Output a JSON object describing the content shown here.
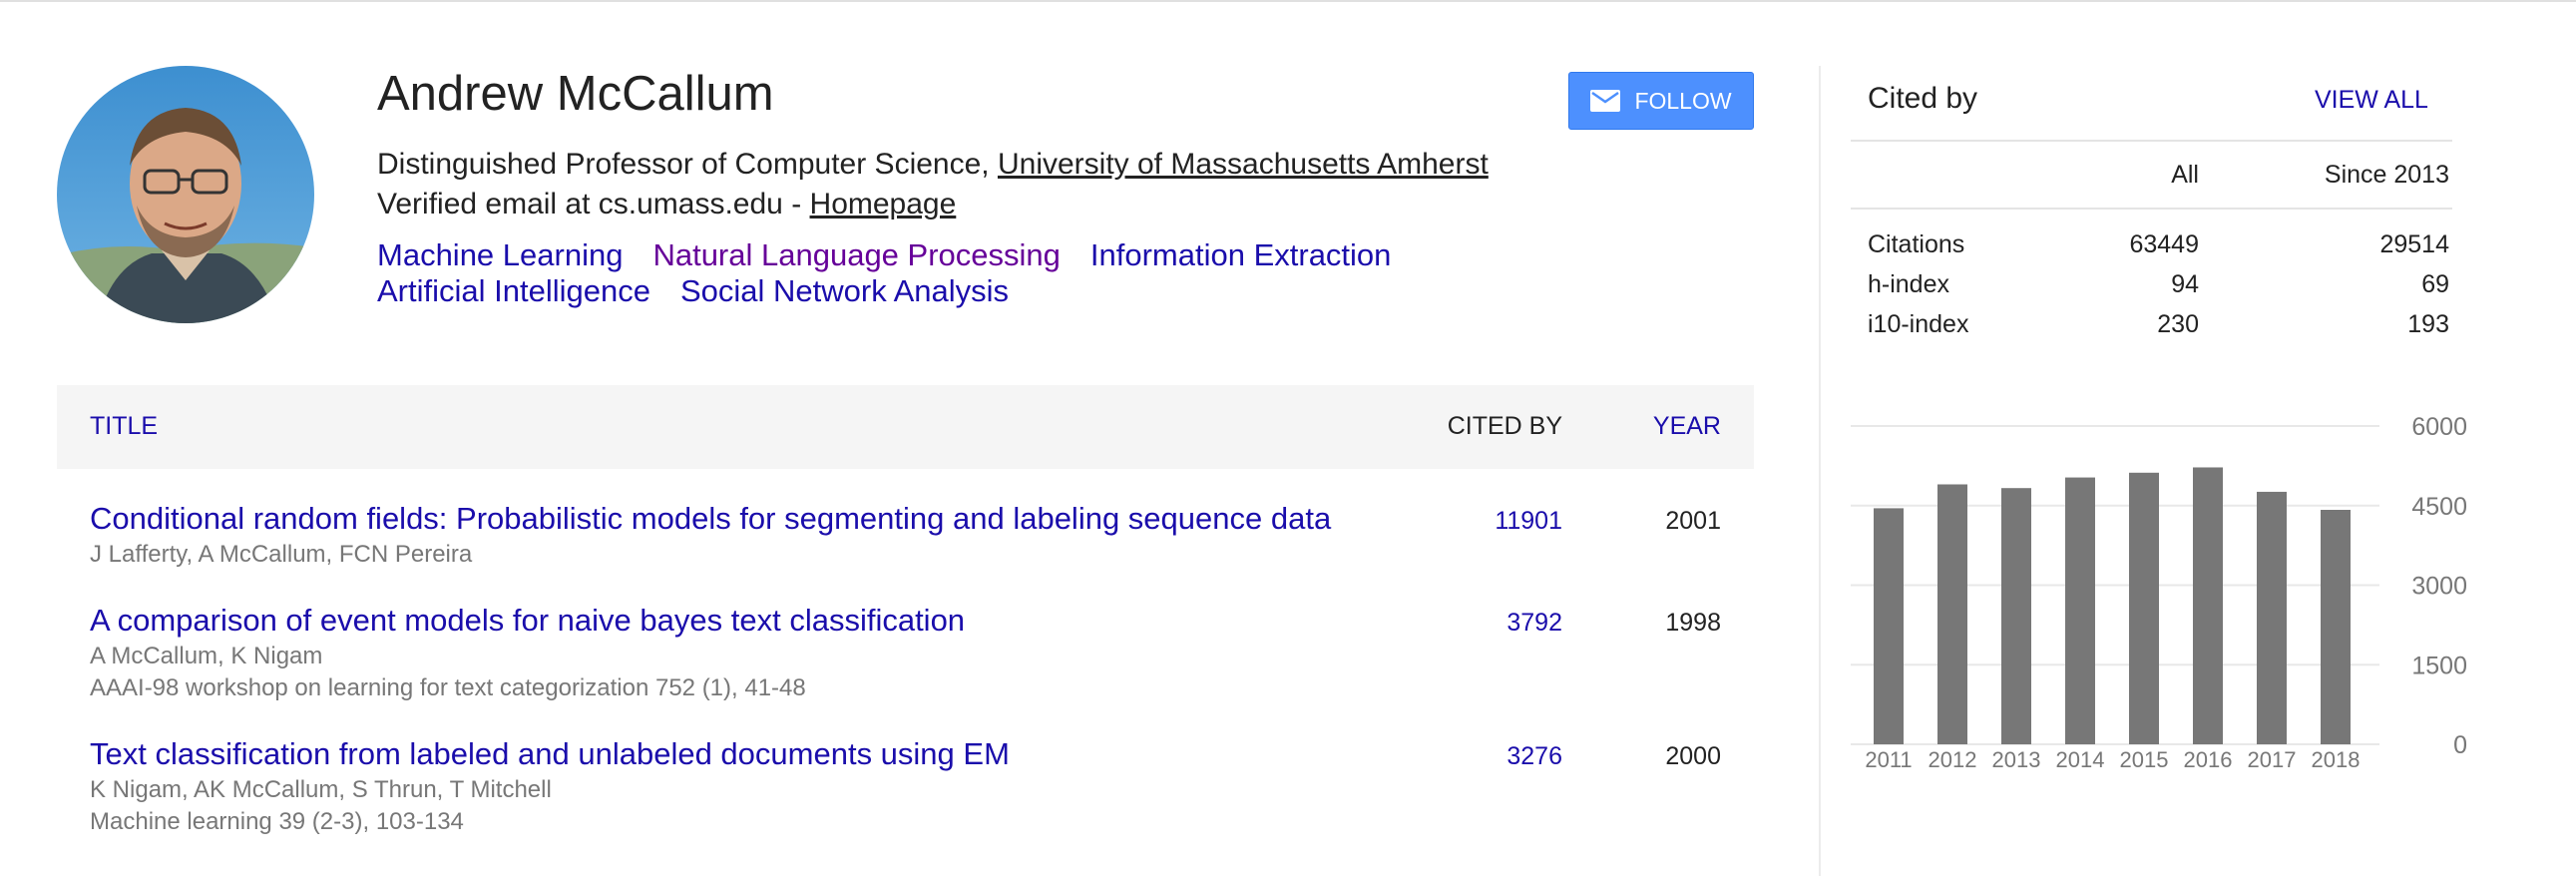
{
  "profile": {
    "name": "Andrew McCallum",
    "affiliation_prefix": "Distinguished Professor of Computer Science, ",
    "affiliation_link": "University of Massachusetts Amherst",
    "email_text": "Verified email at cs.umass.edu - ",
    "homepage_label": "Homepage",
    "follow_label": "FOLLOW",
    "interests": [
      "Machine Learning",
      "Natural Language Processing",
      "Information Extraction",
      "Artificial Intelligence",
      "Social Network Analysis"
    ]
  },
  "table": {
    "header_title": "TITLE",
    "header_cited": "CITED BY",
    "header_year": "YEAR",
    "articles": [
      {
        "title": "Conditional random fields: Probabilistic models for segmenting and labeling sequence data",
        "authors": "J Lafferty, A McCallum, FCN Pereira",
        "venue": "",
        "cited_by": "11901",
        "year": "2001"
      },
      {
        "title": "A comparison of event models for naive bayes text classification",
        "authors": "A McCallum, K Nigam",
        "venue": "AAAI-98 workshop on learning for text categorization 752 (1), 41-48",
        "cited_by": "3792",
        "year": "1998"
      },
      {
        "title": "Text classification from labeled and unlabeled documents using EM",
        "authors": "K Nigam, AK McCallum, S Thrun, T Mitchell",
        "venue": "Machine learning 39 (2-3), 103-134",
        "cited_by": "3276",
        "year": "2000"
      }
    ]
  },
  "cited_by": {
    "title": "Cited by",
    "view_all": "VIEW ALL",
    "col_all": "All",
    "col_since": "Since 2013",
    "rows": [
      {
        "label": "Citations",
        "all": "63449",
        "since": "29514"
      },
      {
        "label": "h-index",
        "all": "94",
        "since": "69"
      },
      {
        "label": "i10-index",
        "all": "230",
        "since": "193"
      }
    ]
  },
  "chart_data": {
    "type": "bar",
    "categories": [
      "2011",
      "2012",
      "2013",
      "2014",
      "2015",
      "2016",
      "2017",
      "2018"
    ],
    "values": [
      4450,
      4900,
      4830,
      5030,
      5120,
      5220,
      4760,
      4420
    ],
    "yticks": [
      "0",
      "1500",
      "3000",
      "4500",
      "6000"
    ],
    "ylim": [
      0,
      6000
    ],
    "bar_color": "#777777",
    "grid": true,
    "title": "",
    "xlabel": "",
    "ylabel": ""
  },
  "colors": {
    "link": "#1a0dab",
    "visited_link": "#660099",
    "follow_button": "#4d90fe",
    "bar": "#777777"
  }
}
